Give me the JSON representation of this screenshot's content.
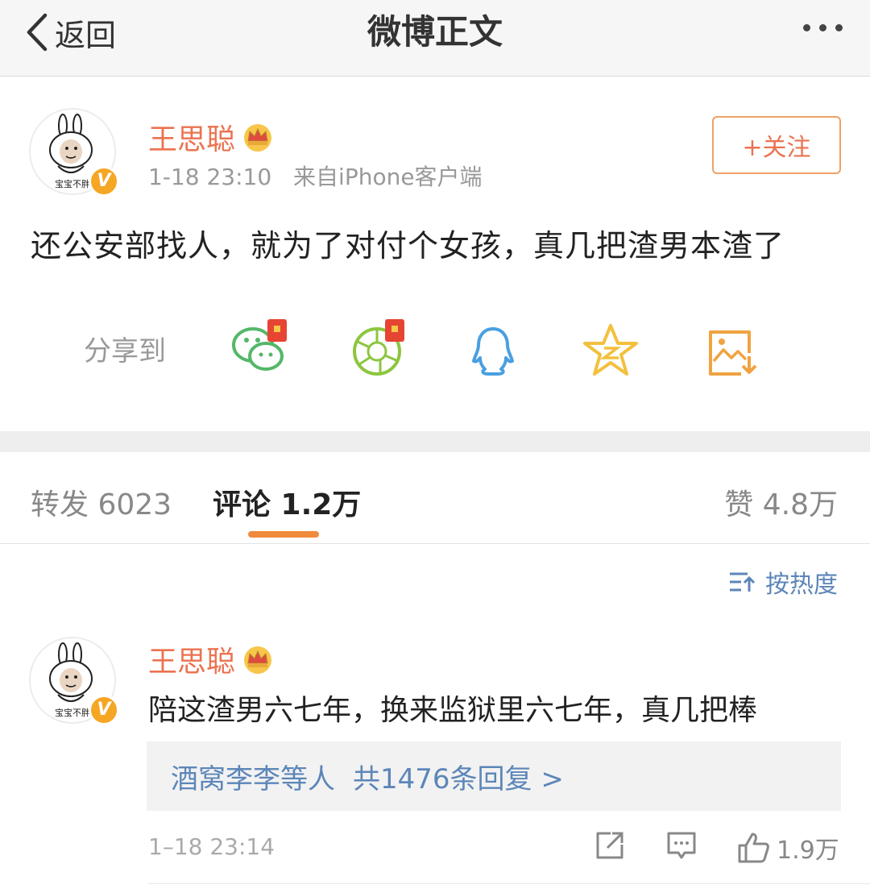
{
  "nav": {
    "back_label": "返回",
    "title": "微博正文"
  },
  "post": {
    "author": "王思聪",
    "avatar_caption": "宝宝不胖",
    "badge": "V",
    "time": "1-18 23:10",
    "source": "来自iPhone客户端",
    "follow_label": "+关注",
    "text": "还公安部找人，就为了对付个女孩，真几把渣男本渣了",
    "share_label": "分享到",
    "share_targets": [
      "wechat-icon",
      "moments-icon",
      "qq-icon",
      "qzone-icon",
      "save-image-icon"
    ]
  },
  "tabs": {
    "repost": "转发 6023",
    "comment": "评论 1.2万",
    "likes": "赞 4.8万"
  },
  "sort_label": "按热度",
  "comment": {
    "author": "王思聪",
    "avatar_caption": "宝宝不胖",
    "badge": "V",
    "text": "陪这渣男六七年，换来监狱里六七年，真几把棒",
    "reply_users": "酒窝李李等人",
    "reply_count": "共1476条回复 >",
    "time": "1–18 23:14",
    "like_count": "1.9万"
  },
  "colors": {
    "accent": "#eb7350",
    "link": "#5c86b8",
    "tab_underline": "#f08a3c",
    "vip_badge": "#f5a623"
  }
}
